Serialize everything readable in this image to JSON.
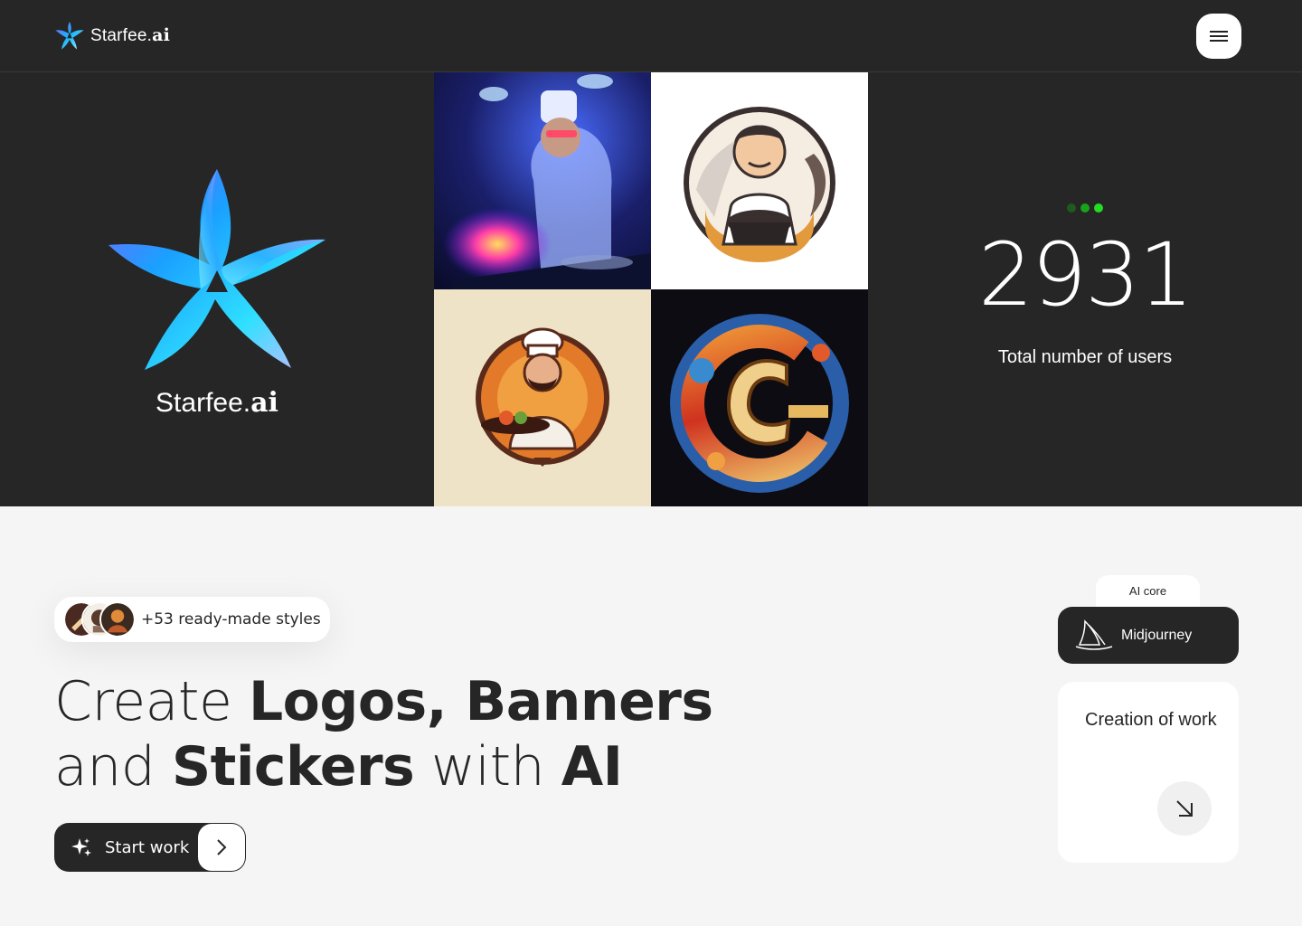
{
  "header": {
    "brand_prefix": "Starfee.",
    "brand_suffix": "ai",
    "menu_icon": "hamburger-icon"
  },
  "hero": {
    "logo_prefix": "Starfee.",
    "logo_suffix": "ai",
    "gallery": [
      {
        "name": "chef-cooking-neon"
      },
      {
        "name": "samurai-chef-logo"
      },
      {
        "name": "chef-with-bowl-logo"
      },
      {
        "name": "letter-c-ornament"
      }
    ],
    "status_dots": [
      "#1f5a1f",
      "#19a319",
      "#22dd22"
    ],
    "user_count": "2931",
    "user_caption": "Total number of users"
  },
  "styles_pill": {
    "label": "+53 ready-made styles"
  },
  "headline": {
    "w1": "Create ",
    "b1": "Logos, Banners",
    "w2": "and ",
    "b2": "Stickers",
    "w3": " with ",
    "b3": "AI"
  },
  "start_button": {
    "label": "Start work",
    "icon": "sparkle-icon",
    "arrow_icon": "chevron-right-icon"
  },
  "ai_core": {
    "tab_label": "AI core",
    "model_label": "Midjourney",
    "model_icon": "sailboat-icon"
  },
  "creation_card": {
    "title": "Creation of work",
    "icon": "arrow-down-right-icon"
  },
  "colors": {
    "dark": "#262626",
    "light_bg": "#f5f5f5",
    "white": "#ffffff"
  }
}
